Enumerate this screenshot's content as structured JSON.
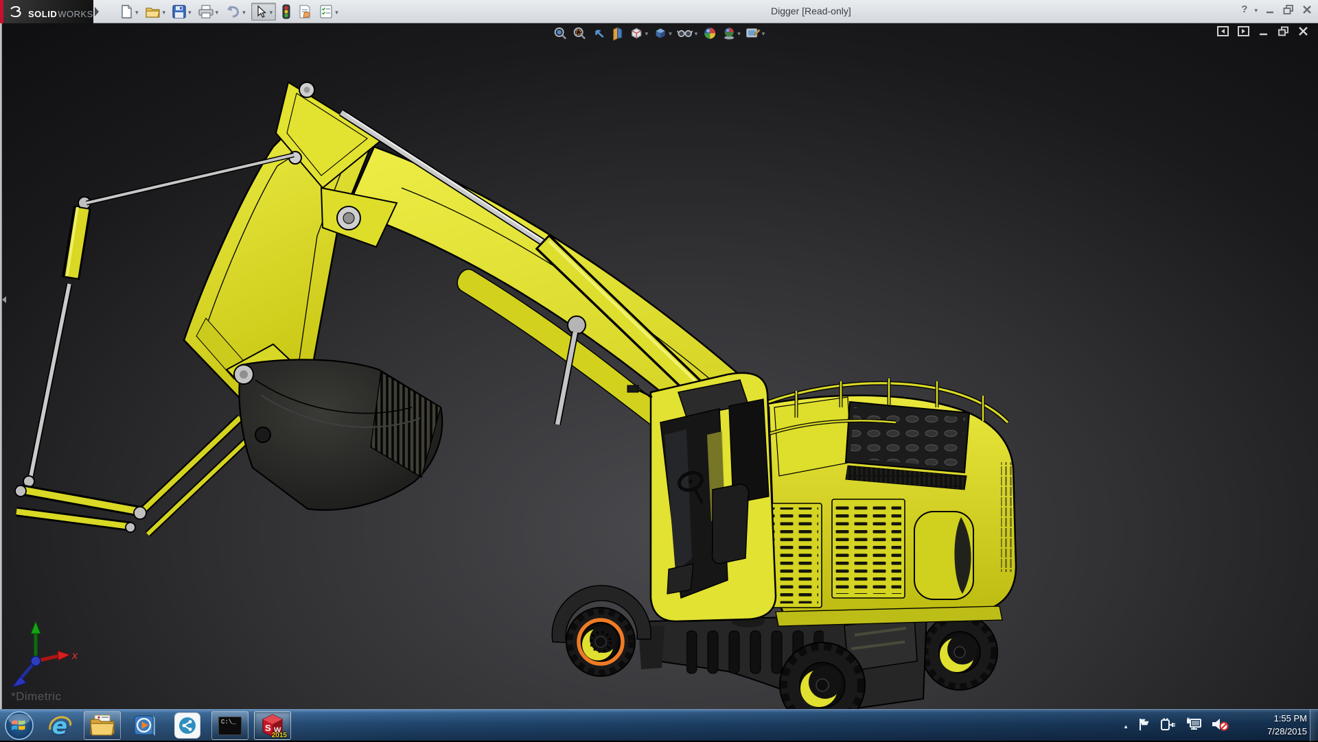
{
  "titlebar": {
    "brand_bold": "SOLID",
    "brand_light": "WORKS",
    "title": "Digger [Read-only]",
    "toolbar_icons": [
      "new-document",
      "open",
      "save",
      "print",
      "undo",
      "select",
      "rebuild",
      "file-properties",
      "options"
    ],
    "window_controls": [
      "help",
      "minimize",
      "restore",
      "close"
    ]
  },
  "headsup": {
    "icons": [
      "zoom-to-fit",
      "zoom-to-area",
      "previous-view",
      "section-view",
      "view-orientation",
      "display-style",
      "hide-show-items",
      "edit-appearance",
      "apply-scene",
      "view-settings"
    ]
  },
  "viewport": {
    "view_orientation_label": "*Dimetric",
    "triad": {
      "x_label": "x"
    },
    "document_controls": [
      "show-pane-left",
      "show-pane-right",
      "minimize",
      "restore",
      "close"
    ],
    "model": {
      "name": "Digger excavator 3D model",
      "body_color": "#dedc2a",
      "highlight_ring_color": "#ef7b25"
    }
  },
  "taskbar": {
    "apps": [
      "start",
      "internet-explorer",
      "windows-explorer",
      "media-player",
      "share-app",
      "command-prompt",
      "solidworks-2015"
    ],
    "solidworks_badge": "2015",
    "cmd_prompt_text": "C:\\_",
    "tray_icons": [
      "hidden-icons",
      "action-center-flag",
      "power-plug",
      "network",
      "volume-muted"
    ],
    "clock": {
      "time": "1:55 PM",
      "date": "7/28/2015"
    }
  }
}
